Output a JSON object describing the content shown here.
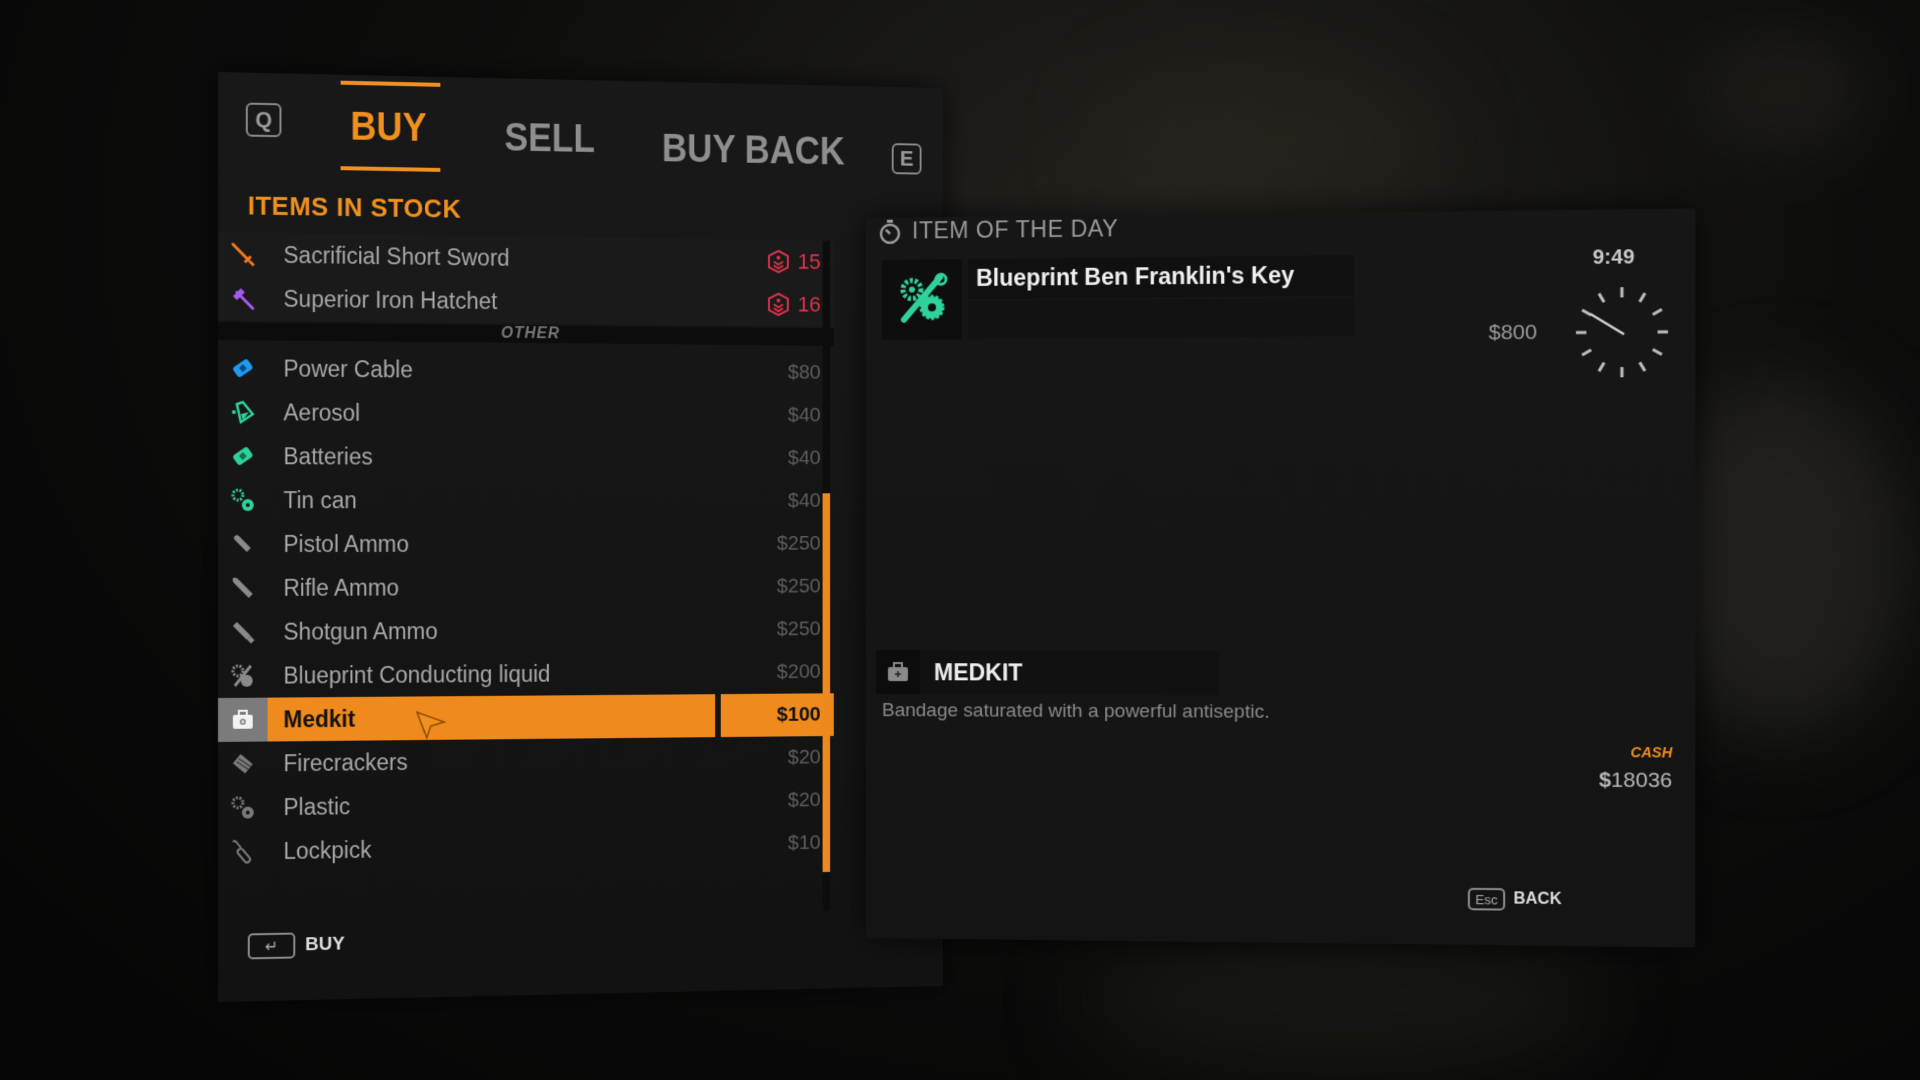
{
  "colors": {
    "accent": "#f0901e",
    "rank_red": "#e0314a",
    "teal": "#2fd39a",
    "blue": "#1e9bf0",
    "purple": "#a45be8"
  },
  "tabs": {
    "prev_key": "Q",
    "next_key": "E",
    "items": [
      {
        "label": "BUY",
        "active": true
      },
      {
        "label": "SELL",
        "active": false
      },
      {
        "label": "BUY BACK",
        "active": false
      }
    ]
  },
  "stock": {
    "title": "ITEMS IN STOCK",
    "weapons": [
      {
        "name": "Sacrificial Short Sword",
        "rank": "15",
        "icon": "sword-icon"
      },
      {
        "name": "Superior Iron Hatchet",
        "rank": "16",
        "icon": "hatchet-icon"
      }
    ],
    "divider": "OTHER",
    "items": [
      {
        "name": "Power Cable",
        "price": "$80",
        "icon": "power-cable-icon"
      },
      {
        "name": "Aerosol",
        "price": "$40",
        "icon": "aerosol-icon"
      },
      {
        "name": "Batteries",
        "price": "$40",
        "icon": "batteries-icon"
      },
      {
        "name": "Tin can",
        "price": "$40",
        "icon": "gears-icon"
      },
      {
        "name": "Pistol Ammo",
        "price": "$250",
        "icon": "bullet-icon"
      },
      {
        "name": "Rifle Ammo",
        "price": "$250",
        "icon": "bullet-icon"
      },
      {
        "name": "Shotgun Ammo",
        "price": "$250",
        "icon": "shell-icon"
      },
      {
        "name": "Blueprint Conducting liquid",
        "price": "$200",
        "icon": "blueprint-icon"
      },
      {
        "name": "Medkit",
        "price": "$100",
        "icon": "medkit-icon",
        "selected": true
      },
      {
        "name": "Firecrackers",
        "price": "$20",
        "icon": "firecrackers-icon"
      },
      {
        "name": "Plastic",
        "price": "$20",
        "icon": "gears-icon"
      },
      {
        "name": "Lockpick",
        "price": "$10",
        "icon": "lockpick-icon"
      }
    ]
  },
  "footer": {
    "buy_key": "↵",
    "buy_label": "BUY",
    "back_key": "Esc",
    "back_label": "BACK"
  },
  "item_of_the_day": {
    "title": "ITEM OF THE DAY",
    "name": "Blueprint Ben Franklin's Key",
    "price": "$800",
    "time_left": "9:49"
  },
  "details": {
    "name": "MEDKIT",
    "description": "Bandage saturated with a powerful antiseptic."
  },
  "wallet": {
    "label": "CASH",
    "currency": "$",
    "amount": "18036"
  }
}
